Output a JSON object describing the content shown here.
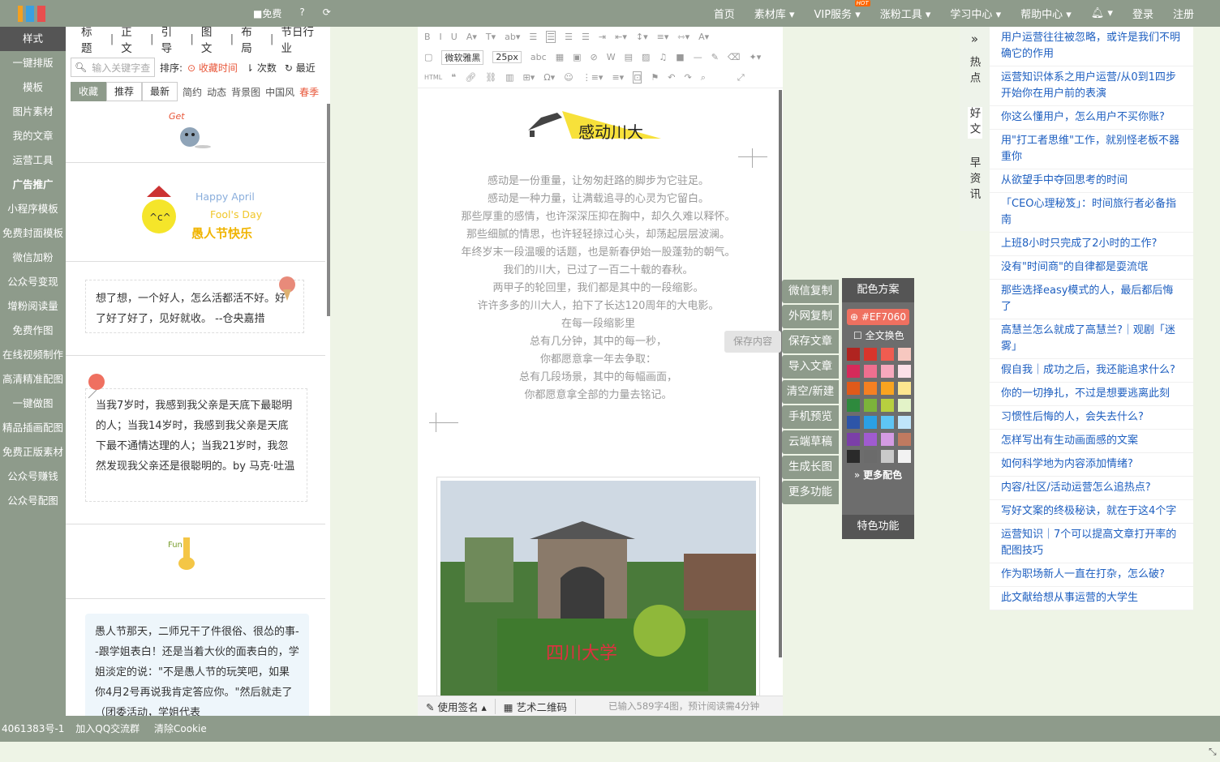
{
  "topbar": {
    "free_label": "■免费",
    "nav": [
      "首页",
      "素材库",
      "VIP服务",
      "涨粉工具",
      "学习中心",
      "帮助中心",
      "登录",
      "注册"
    ],
    "hot_badge": "HOT"
  },
  "leftnav": [
    "样式",
    "一键排版",
    "模板",
    "图片素材",
    "我的文章",
    "运营工具",
    "广告推广",
    "小程序模板",
    "免费封面模板",
    "微信加粉",
    "公众号变现",
    "增粉阅读量",
    "免费作图",
    "在线视频制作",
    "高清精准配图",
    "一键做图",
    "精品插画配图",
    "免费正版素材",
    "公众号赚钱",
    "公众号配图"
  ],
  "panel": {
    "tabs": [
      "标题",
      "正文",
      "引导",
      "图文",
      "布局",
      "节日行业"
    ],
    "search_placeholder": "输入关键字查",
    "sort_label": "排序:",
    "sort_options": [
      "收藏时间",
      "次数",
      "最近"
    ],
    "filters": [
      "收藏",
      "推荐",
      "最新"
    ],
    "tags": [
      "简约",
      "动态",
      "背景图",
      "中国风",
      "春季"
    ],
    "card_get": "Get",
    "april_en": "Happy April",
    "fools_en": "Fool's Day",
    "april_cn": "愚人节快乐",
    "fun": "Fun",
    "quote1": "想了想，一个好人，怎么活都活不好。好了好了好了，见好就收。 --仓央嘉措",
    "quote2": "当我7岁时，我感到我父亲是天底下最聪明的人；当我14岁时，我感到我父亲是天底下最不通情达理的人；当我21岁时，我忽然发现我父亲还是很聪明的。by 马克·吐温",
    "quote3": "愚人节那天，二师兄干了件很俗、很怂的事--跟学姐表白！还是当着大伙的面表白的，学姐淡定的说：\"不是愚人节的玩笑吧，如果你4月2号再说我肯定答应你。\"然后就走了（团委活动，学姐代表"
  },
  "editor": {
    "font": "微软雅黑",
    "size": "25px",
    "title": "感动川大",
    "lines": [
      "感动是一份重量，让匆匆赶路的脚步为它驻足。",
      "感动是一种力量，让满载追寻的心灵为它留白。",
      "那些厚重的感情，也许深深压抑在胸中，却久久难以释怀。",
      "那些细腻的情思，也许轻轻掠过心头，却荡起层层波澜。",
      "年终岁末一段温暖的话题，也是新春伊始一股蓬勃的朝气。",
      "我们的川大，已过了一百二十载的春秋。",
      "两甲子的轮回里，我们都是其中的一段缩影。",
      "许许多多的川大人，拍下了长达120周年的大电影。",
      "在每一段缩影里",
      "总有几分钟，其中的每一秒，",
      "你都愿意拿一年去争取：",
      "总有几段场景，其中的每幅画面，",
      "你都愿意拿全部的力量去铭记。"
    ],
    "signature": "使用签名",
    "qrcode": "艺术二维码",
    "status": "已输入589字4图，预计阅读需4分钟"
  },
  "side_buttons": [
    "微信复制",
    "外网复制",
    "保存文章",
    "导入文章",
    "清空/新建",
    "手机预览",
    "云端草稿",
    "生成长图",
    "更多功能"
  ],
  "save_tip": "保存内容",
  "color_panel": {
    "title": "配色方案",
    "current": "#EF7060",
    "fulltext": "全文换色",
    "more": "更多配色",
    "special": "特色功能"
  },
  "swatches": [
    "#b02420",
    "#d9352b",
    "#f05c50",
    "#f7c8c0",
    "#d62a5a",
    "#ef6f8f",
    "#f7a8bd",
    "#fbe0e8",
    "#e05a1a",
    "#f58022",
    "#f9a420",
    "#fde68f",
    "#2e8a3d",
    "#7cb33a",
    "#b7cf3f",
    "#e3f3c8",
    "#2d55a8",
    "#2aa0e5",
    "#5ec5f5",
    "#bfe5fb",
    "#7b3fa8",
    "#a05bd0",
    "#d49be3",
    "#c07a60",
    "#2a2a2a",
    "#6b6b6b",
    "#c9c9c9",
    "#f2f2f2"
  ],
  "righttabs": [
    "热点",
    "好文",
    "早资讯"
  ],
  "rightlist": [
    "用户运营往往被忽略，或许是我们不明确它的作用",
    "运营知识体系之用户运营/从0到1四步开始你在用户前的表演",
    "你这么懂用户，怎么用户不买你账?",
    "用\"打工者思维\"工作，就别怪老板不器重你",
    "从欲望手中夺回思考的时间",
    "「CEO心理秘笈」：时间旅行者必备指南",
    "上班8小时只完成了2小时的工作?",
    "没有\"时间商\"的自律都是耍流氓",
    "那些选择easy模式的人，最后都后悔了",
    "高慧兰怎么就成了高慧兰?｜观剧「迷雾」",
    "假自我｜成功之后，我还能追求什么?",
    "你的一切挣扎，不过是想要逃离此刻",
    "习惯性后悔的人，会失去什么?",
    "怎样写出有生动画面感的文案",
    "如何科学地为内容添加情绪?",
    "内容/社区/活动运营怎么追热点?",
    "写好文案的终极秘诀，就在于这4个字",
    "运营知识｜7个可以提高文章打开率的配图技巧",
    "作为职场新人一直在打杂，怎么破?",
    "此文献给想从事运营的大学生"
  ],
  "footer": {
    "icp": "4061383号-1",
    "qq": "加入QQ交流群",
    "cookie": "清除Cookie"
  }
}
